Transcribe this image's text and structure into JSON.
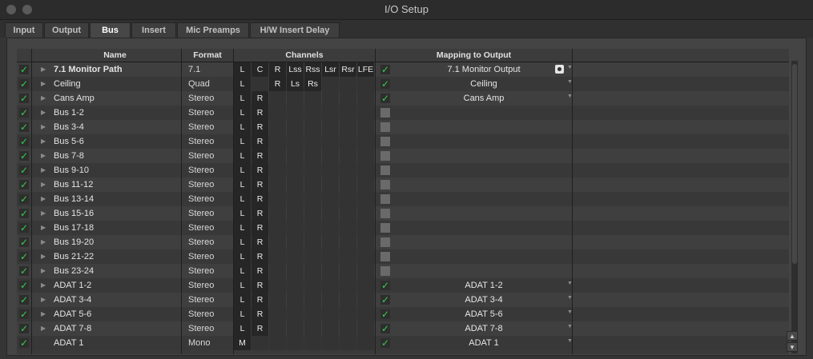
{
  "window": {
    "title": "I/O Setup"
  },
  "tabs": [
    {
      "label": "Input",
      "active": false
    },
    {
      "label": "Output",
      "active": false
    },
    {
      "label": "Bus",
      "active": true
    },
    {
      "label": "Insert",
      "active": false
    },
    {
      "label": "Mic Preamps",
      "active": false
    },
    {
      "label": "H/W Insert Delay",
      "active": false
    }
  ],
  "columns": {
    "name": "Name",
    "format": "Format",
    "channels": "Channels",
    "mapping": "Mapping to Output",
    "channel_labels": [
      "L",
      "C",
      "R",
      "Lss",
      "Rss",
      "Lsr",
      "Rsr",
      "LFE"
    ]
  },
  "colors": {
    "check": "#35d04a",
    "background": "#353535",
    "channel_bg": "#262626"
  },
  "rows": [
    {
      "name": "7.1 Monitor Path",
      "bold": true,
      "format": "7.1",
      "channels": [
        "L",
        "C",
        "R",
        "Lss",
        "Rss",
        "Lsr",
        "Rsr",
        "LFE"
      ],
      "map_checked": true,
      "mapping": "7.1 Monitor Output",
      "monitor_icon": true,
      "dropdown": true,
      "expand": true
    },
    {
      "name": "Ceiling",
      "format": "Quad",
      "channels": [
        "L",
        "",
        "R",
        "Ls",
        "Rs"
      ],
      "map_checked": true,
      "mapping": "Ceiling",
      "dropdown": true,
      "expand": true
    },
    {
      "name": "Cans Amp",
      "format": "Stereo",
      "channels": [
        "L",
        "R"
      ],
      "map_checked": true,
      "mapping": "Cans Amp",
      "dropdown": true,
      "expand": true
    },
    {
      "name": "Bus 1-2",
      "format": "Stereo",
      "channels": [
        "L",
        "R"
      ],
      "map_checked": false,
      "mapping": "",
      "expand": true
    },
    {
      "name": "Bus 3-4",
      "format": "Stereo",
      "channels": [
        "L",
        "R"
      ],
      "map_checked": false,
      "mapping": "",
      "expand": true
    },
    {
      "name": "Bus 5-6",
      "format": "Stereo",
      "channels": [
        "L",
        "R"
      ],
      "map_checked": false,
      "mapping": "",
      "expand": true
    },
    {
      "name": "Bus 7-8",
      "format": "Stereo",
      "channels": [
        "L",
        "R"
      ],
      "map_checked": false,
      "mapping": "",
      "expand": true
    },
    {
      "name": "Bus 9-10",
      "format": "Stereo",
      "channels": [
        "L",
        "R"
      ],
      "map_checked": false,
      "mapping": "",
      "expand": true
    },
    {
      "name": "Bus 11-12",
      "format": "Stereo",
      "channels": [
        "L",
        "R"
      ],
      "map_checked": false,
      "mapping": "",
      "expand": true
    },
    {
      "name": "Bus 13-14",
      "format": "Stereo",
      "channels": [
        "L",
        "R"
      ],
      "map_checked": false,
      "mapping": "",
      "expand": true
    },
    {
      "name": "Bus 15-16",
      "format": "Stereo",
      "channels": [
        "L",
        "R"
      ],
      "map_checked": false,
      "mapping": "",
      "expand": true
    },
    {
      "name": "Bus 17-18",
      "format": "Stereo",
      "channels": [
        "L",
        "R"
      ],
      "map_checked": false,
      "mapping": "",
      "expand": true
    },
    {
      "name": "Bus 19-20",
      "format": "Stereo",
      "channels": [
        "L",
        "R"
      ],
      "map_checked": false,
      "mapping": "",
      "expand": true
    },
    {
      "name": "Bus 21-22",
      "format": "Stereo",
      "channels": [
        "L",
        "R"
      ],
      "map_checked": false,
      "mapping": "",
      "expand": true
    },
    {
      "name": "Bus 23-24",
      "format": "Stereo",
      "channels": [
        "L",
        "R"
      ],
      "map_checked": false,
      "mapping": "",
      "expand": true
    },
    {
      "name": "ADAT 1-2",
      "format": "Stereo",
      "channels": [
        "L",
        "R"
      ],
      "map_checked": true,
      "mapping": "ADAT 1-2",
      "dropdown": true,
      "expand": true
    },
    {
      "name": "ADAT 3-4",
      "format": "Stereo",
      "channels": [
        "L",
        "R"
      ],
      "map_checked": true,
      "mapping": "ADAT 3-4",
      "dropdown": true,
      "expand": true
    },
    {
      "name": "ADAT 5-6",
      "format": "Stereo",
      "channels": [
        "L",
        "R"
      ],
      "map_checked": true,
      "mapping": "ADAT 5-6",
      "dropdown": true,
      "expand": true
    },
    {
      "name": "ADAT 7-8",
      "format": "Stereo",
      "channels": [
        "L",
        "R"
      ],
      "map_checked": true,
      "mapping": "ADAT 7-8",
      "dropdown": true,
      "expand": true
    },
    {
      "name": "ADAT 1",
      "format": "Mono",
      "channels": [
        "M"
      ],
      "map_checked": true,
      "mapping": "ADAT 1",
      "dropdown": true,
      "expand": false
    }
  ],
  "scrollbar": {
    "up_icon": "arrow-up-icon",
    "down_icon": "arrow-down-icon"
  }
}
